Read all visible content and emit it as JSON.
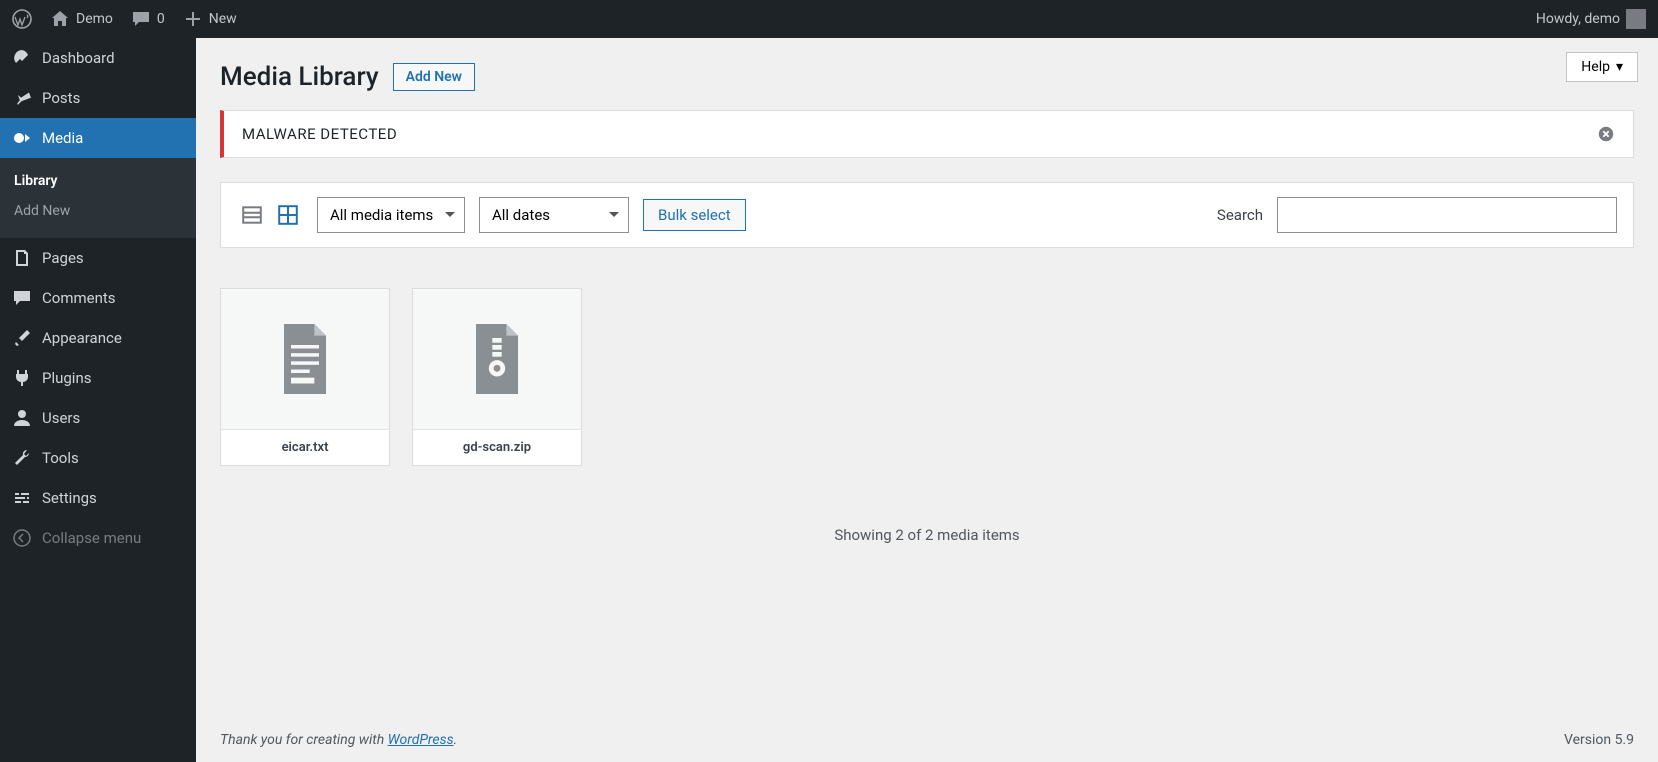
{
  "adminbar": {
    "site_name": "Demo",
    "comments_count": "0",
    "new_label": "New",
    "howdy": "Howdy, demo"
  },
  "sidebar": {
    "dashboard": "Dashboard",
    "posts": "Posts",
    "media": "Media",
    "media_sub": {
      "library": "Library",
      "add_new": "Add New"
    },
    "pages": "Pages",
    "comments": "Comments",
    "appearance": "Appearance",
    "plugins": "Plugins",
    "users": "Users",
    "tools": "Tools",
    "settings": "Settings",
    "collapse": "Collapse menu"
  },
  "header": {
    "title": "Media Library",
    "add_new": "Add New",
    "help": "Help"
  },
  "notice": {
    "text": "MALWARE DETECTED"
  },
  "toolbar": {
    "filter_type": "All media items",
    "filter_date": "All dates",
    "bulk_select": "Bulk select",
    "search_label": "Search"
  },
  "media": {
    "items": [
      {
        "name": "eicar.txt",
        "type": "text"
      },
      {
        "name": "gd-scan.zip",
        "type": "archive"
      }
    ],
    "showing": "Showing 2 of 2 media items"
  },
  "footer": {
    "thanks_prefix": "Thank you for creating with ",
    "wp_link": "WordPress",
    "thanks_suffix": ".",
    "version": "Version 5.9"
  }
}
